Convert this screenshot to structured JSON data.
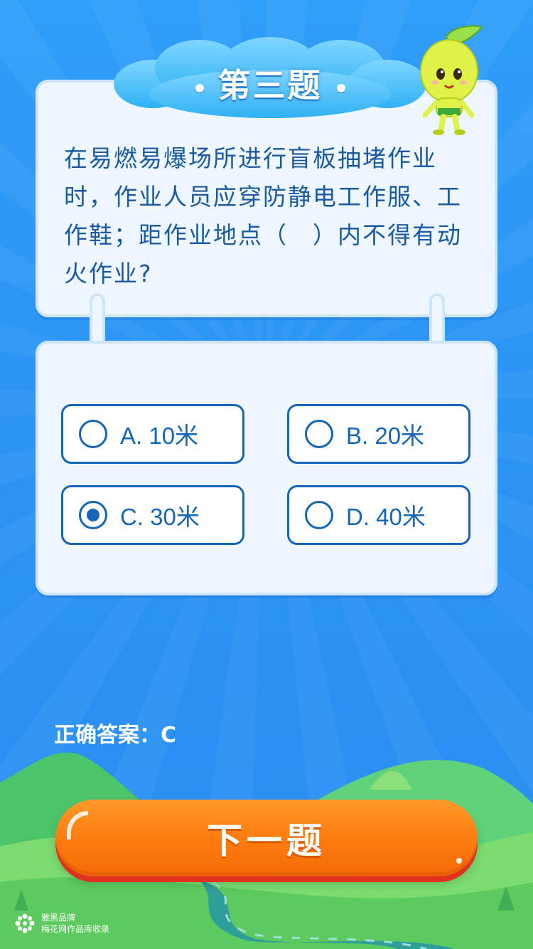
{
  "title": "第三题",
  "question": "在易燃易爆场所进行盲板抽堵作业时，作业人员应穿防静电工作服、工作鞋；距作业地点（　）内不得有动火作业?",
  "options": [
    {
      "label": "A. 10米",
      "selected": false
    },
    {
      "label": "B. 20米",
      "selected": false
    },
    {
      "label": "C. 30米",
      "selected": true
    },
    {
      "label": "D. 40米",
      "selected": false
    }
  ],
  "answer_text": "正确答案：C",
  "next_button": "下一题",
  "watermark": {
    "line1": "雅黑品牌",
    "line2": "梅花网作品库收录"
  },
  "colors": {
    "background": "#2b93f4",
    "card": "#eef6ff",
    "question_text": "#1a5aa0",
    "option_accent": "#1565b8",
    "button": "#ff7b0e",
    "button_shadow": "#e2301e"
  }
}
